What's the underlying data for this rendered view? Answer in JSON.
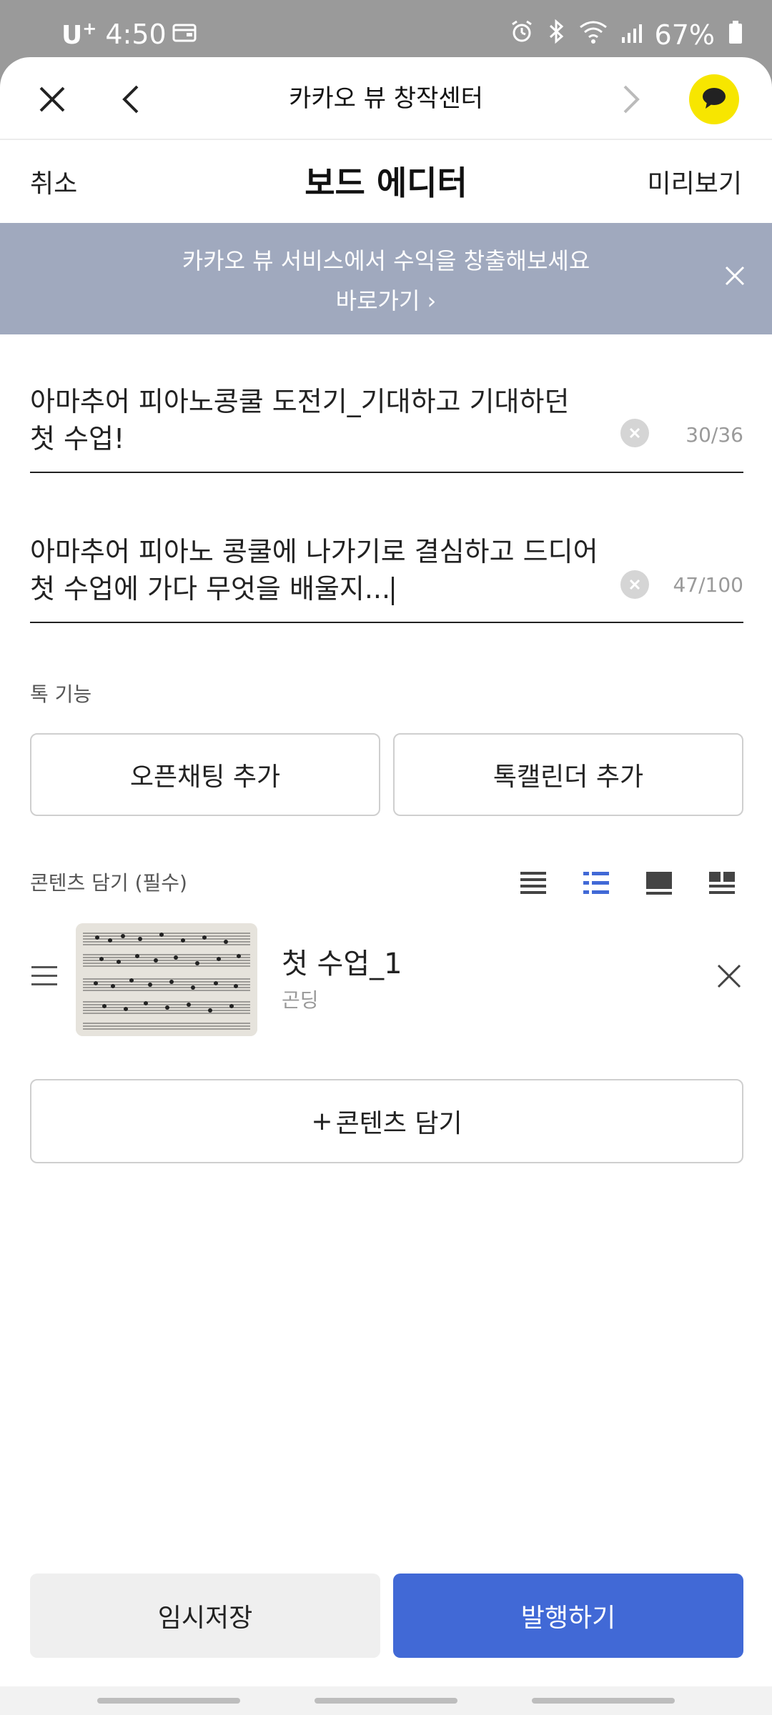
{
  "status_bar": {
    "carrier": "U",
    "carrier_sup": "+",
    "time": "4:50",
    "battery": "67%"
  },
  "browser": {
    "title": "카카오 뷰 창작센터"
  },
  "editor": {
    "cancel": "취소",
    "title": "보드 에디터",
    "preview": "미리보기"
  },
  "banner": {
    "text": "카카오 뷰 서비스에서 수익을 창출해보세요",
    "link": "바로가기 ›"
  },
  "title_field": {
    "line1": "아마추어 피아노콩쿨 도전기_기대하고 기대하던",
    "line2": "첫 수업!",
    "count": "30/36"
  },
  "desc_field": {
    "line1": "아마추어 피아노 콩쿨에 나가기로 결심하고 드디어",
    "line2": "첫 수업에 가다 무엇을 배울지...",
    "count": "47/100"
  },
  "talk_features": {
    "label": "톡 기능",
    "open_chat": "오픈채팅 추가",
    "talk_calendar": "톡캘린더 추가"
  },
  "contents": {
    "label": "콘텐츠 담기 (필수)",
    "view_modes": [
      "list-icon",
      "list-bullet-icon",
      "card-icon",
      "grid-icon"
    ],
    "active_view": "list-bullet-icon",
    "items": [
      {
        "title": "첫 수업_1",
        "subtitle": "곤딩"
      }
    ],
    "add_button": "콘텐츠 담기",
    "add_symbol": "+"
  },
  "footer": {
    "save": "임시저장",
    "publish": "발행하기"
  },
  "colors": {
    "accent": "#4169d6",
    "banner": "#a0a9be",
    "kakao_yellow": "#f7e600"
  }
}
